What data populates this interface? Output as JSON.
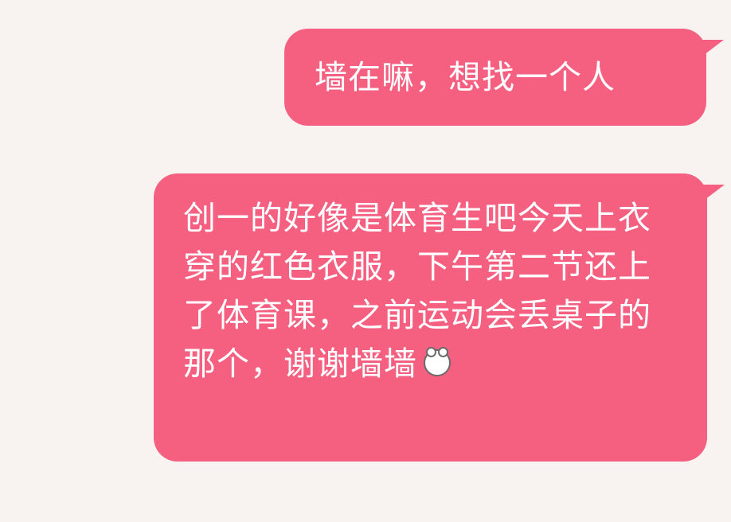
{
  "chat": {
    "bubble_color": "#f56080",
    "background_color": "#f8f2f0",
    "messages": [
      {
        "side": "right",
        "text": "墙在嘛，想找一个人"
      },
      {
        "side": "right",
        "text": "创一的好像是体育生吧今天上衣穿的红色衣服，下午第二节还上了体育课，之前运动会丢桌子的那个，谢谢墙墙",
        "emoji": "panda-face-icon"
      }
    ]
  }
}
